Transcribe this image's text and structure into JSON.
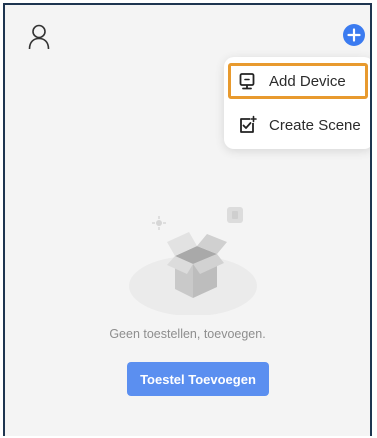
{
  "header": {
    "profile_icon": "person-outline-icon",
    "add_icon": "plus-circle-icon",
    "accent_color": "#3b7bf0"
  },
  "menu": {
    "items": [
      {
        "label": "Add Device",
        "icon": "add-device-icon",
        "highlighted": true
      },
      {
        "label": "Create Scene",
        "icon": "create-scene-icon",
        "highlighted": false
      }
    ],
    "highlight_color": "#e89a2e"
  },
  "empty_state": {
    "illustration": "empty-box-icon",
    "message": "Geen toestellen, toevoegen.",
    "button_label": "Toestel Toevoegen",
    "button_color": "#5b8ff0"
  }
}
